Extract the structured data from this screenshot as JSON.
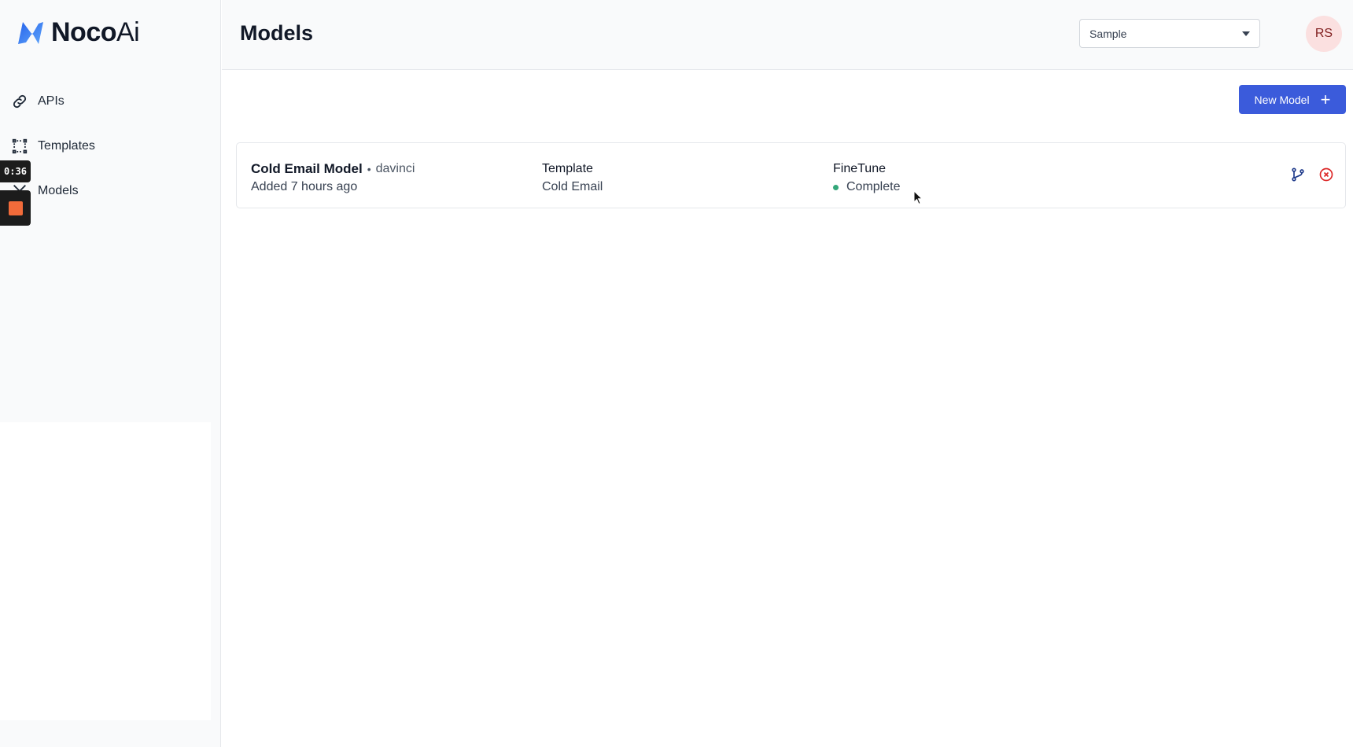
{
  "app": {
    "logo_bold": "Noco",
    "logo_light": "Ai"
  },
  "sidebar": {
    "items": [
      {
        "label": "APIs",
        "icon": "link-icon"
      },
      {
        "label": "Templates",
        "icon": "template-frame-icon"
      },
      {
        "label": "Models",
        "icon": "model-icon"
      }
    ]
  },
  "recorder": {
    "timer": "0:36"
  },
  "header": {
    "title": "Models",
    "project_select": {
      "value": "Sample"
    },
    "avatar_initials": "RS"
  },
  "toolbar": {
    "new_model_label": "New Model"
  },
  "models": [
    {
      "name": "Cold Email Model",
      "separator": "•",
      "engine": "davinci",
      "added": "Added 7 hours ago",
      "template_heading": "Template",
      "template_value": "Cold Email",
      "finetune_heading": "FineTune",
      "finetune_status": "Complete",
      "status_color": "#34a77a"
    }
  ],
  "colors": {
    "accent": "#3b5bdb",
    "danger": "#dc2626",
    "success": "#34a77a"
  }
}
